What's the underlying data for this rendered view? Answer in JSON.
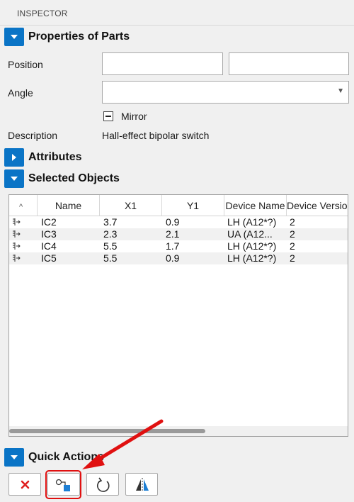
{
  "panel": {
    "title": "INSPECTOR"
  },
  "properties": {
    "title": "Properties of Parts",
    "position_label": "Position",
    "position_x": "",
    "position_y": "",
    "angle_label": "Angle",
    "angle_value": "",
    "mirror_label": "Mirror",
    "mirror_checked": false,
    "description_label": "Description",
    "description_value": "Hall-effect bipolar switch"
  },
  "attributes": {
    "title": "Attributes",
    "expanded": false
  },
  "selected_objects": {
    "title": "Selected Objects",
    "columns": [
      "Name",
      "X1",
      "Y1",
      "Device Name",
      "Device Version"
    ],
    "rows": [
      {
        "name": "IC2",
        "x1": "3.7",
        "y1": "0.9",
        "device_name": "LH (A12*?)",
        "device_version": "2"
      },
      {
        "name": "IC3",
        "x1": "2.3",
        "y1": "2.1",
        "device_name": "UA (A12...",
        "device_version": "2"
      },
      {
        "name": "IC4",
        "x1": "5.5",
        "y1": "1.7",
        "device_name": "LH (A12*?)",
        "device_version": "2"
      },
      {
        "name": "IC5",
        "x1": "5.5",
        "y1": "0.9",
        "device_name": "LH (A12*?)",
        "device_version": "2"
      }
    ],
    "horizontal_scroll_fraction": 0.58
  },
  "quick_actions": {
    "title": "Quick Actions",
    "buttons": [
      {
        "icon": "delete-x-icon",
        "color": "#e02020"
      },
      {
        "icon": "replace-part-icon",
        "color": "#1e7fd4",
        "highlighted": true
      },
      {
        "icon": "rotate-icon"
      },
      {
        "icon": "mirror-flip-icon"
      }
    ]
  },
  "colors": {
    "accent": "#0a74c6",
    "annotation": "#e01010",
    "panel_bg": "#f0f0f0"
  }
}
